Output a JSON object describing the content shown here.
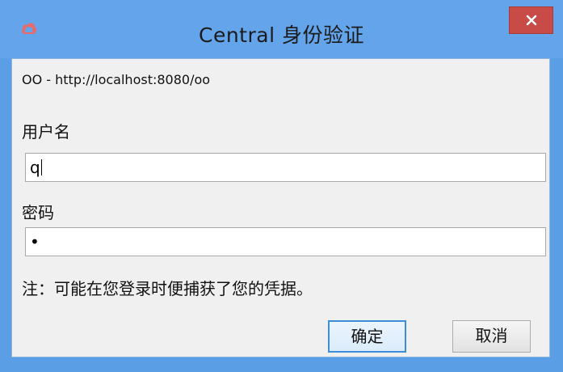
{
  "window": {
    "title": "Central  身份验证",
    "app_icon": "central-app-icon",
    "close_icon": "close-icon"
  },
  "dialog": {
    "server": "OO - http://localhost:8080/oo",
    "username_label": "用户名",
    "username_value": "q",
    "password_label": "密码",
    "password_value": "•",
    "note": "注：可能在您登录时便捕获了您的凭据。",
    "ok_label": "确定",
    "cancel_label": "取消"
  },
  "colors": {
    "titlebar": "#63a4ea",
    "close_button": "#c84b47",
    "primary_button_border": "#3c8fd6"
  }
}
